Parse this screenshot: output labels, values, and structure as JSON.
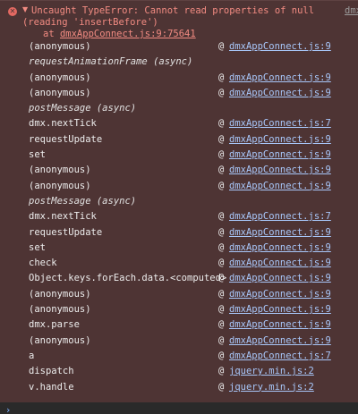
{
  "error": {
    "icon": "x-circle-icon",
    "expand_glyph": "▼",
    "line1": "Uncaught TypeError: Cannot read properties of null",
    "line2": "(reading 'insertBefore')",
    "line3_prefix": "at ",
    "line3_location": "dmxAppConnect.js:9:75641",
    "source_link": "dmx"
  },
  "frames": [
    {
      "fn": "(anonymous)",
      "at": "@",
      "loc": "dmxAppConnect.js:9"
    },
    {
      "fn": "requestAnimationFrame (async)",
      "async": true
    },
    {
      "fn": "(anonymous)",
      "at": "@",
      "loc": "dmxAppConnect.js:9"
    },
    {
      "fn": "(anonymous)",
      "at": "@",
      "loc": "dmxAppConnect.js:9"
    },
    {
      "fn": "postMessage (async)",
      "async": true
    },
    {
      "fn": "dmx.nextTick",
      "at": "@",
      "loc": "dmxAppConnect.js:7"
    },
    {
      "fn": "requestUpdate",
      "at": "@",
      "loc": "dmxAppConnect.js:9"
    },
    {
      "fn": "set",
      "at": "@",
      "loc": "dmxAppConnect.js:9"
    },
    {
      "fn": "(anonymous)",
      "at": "@",
      "loc": "dmxAppConnect.js:9"
    },
    {
      "fn": "(anonymous)",
      "at": "@",
      "loc": "dmxAppConnect.js:9"
    },
    {
      "fn": "postMessage (async)",
      "async": true
    },
    {
      "fn": "dmx.nextTick",
      "at": "@",
      "loc": "dmxAppConnect.js:7"
    },
    {
      "fn": "requestUpdate",
      "at": "@",
      "loc": "dmxAppConnect.js:9"
    },
    {
      "fn": "set",
      "at": "@",
      "loc": "dmxAppConnect.js:9"
    },
    {
      "fn": "check",
      "at": "@",
      "loc": "dmxAppConnect.js:9"
    },
    {
      "fn": "Object.keys.forEach.data.<computed>",
      "at": "@",
      "loc": "dmxAppConnect.js:9"
    },
    {
      "fn": "(anonymous)",
      "at": "@",
      "loc": "dmxAppConnect.js:9"
    },
    {
      "fn": "(anonymous)",
      "at": "@",
      "loc": "dmxAppConnect.js:9"
    },
    {
      "fn": "dmx.parse",
      "at": "@",
      "loc": "dmxAppConnect.js:9"
    },
    {
      "fn": "(anonymous)",
      "at": "@",
      "loc": "dmxAppConnect.js:9"
    },
    {
      "fn": "a",
      "at": "@",
      "loc": "dmxAppConnect.js:7"
    },
    {
      "fn": "dispatch",
      "at": "@",
      "loc": "jquery.min.js:2"
    },
    {
      "fn": "v.handle",
      "at": "@",
      "loc": "jquery.min.js:2"
    }
  ],
  "prompt": {
    "glyph": "›",
    "icon": "chevron-right-icon"
  },
  "colors": {
    "error_bg": "#4e3434",
    "error_text": "#f28b82",
    "link": "#a8c7fa",
    "console_bg": "#2a2a2a"
  }
}
